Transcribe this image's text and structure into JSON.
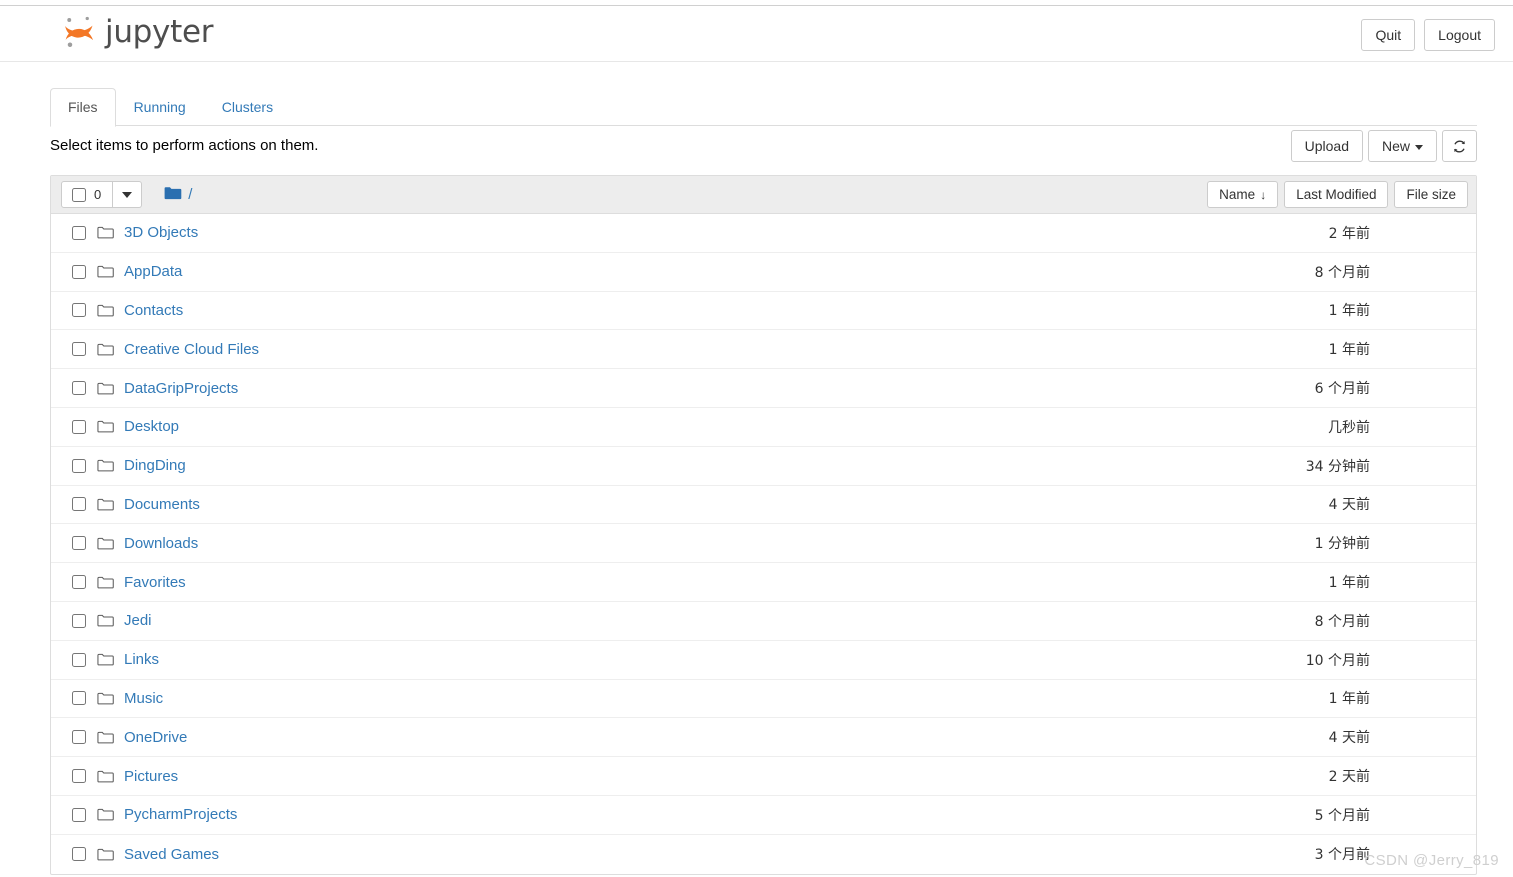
{
  "header": {
    "brand": "jupyter",
    "logo_icon": "jupyter-logo",
    "quit_label": "Quit",
    "logout_label": "Logout"
  },
  "tabs": [
    {
      "label": "Files",
      "active": true
    },
    {
      "label": "Running",
      "active": false
    },
    {
      "label": "Clusters",
      "active": false
    }
  ],
  "actions": {
    "note": "Select items to perform actions on them.",
    "upload_label": "Upload",
    "new_label": "New",
    "new_caret_icon": "chevron-down-icon",
    "refresh_icon": "refresh-icon"
  },
  "list_header": {
    "selected_count": "0",
    "select_caret_icon": "chevron-down-icon",
    "folder_icon": "folder-filled-icon",
    "breadcrumb_root": "/",
    "sort_name": "Name",
    "sort_name_arrow": "↓",
    "sort_last_modified": "Last Modified",
    "sort_file_size": "File size"
  },
  "columns": [
    "Name",
    "Last Modified",
    "File size"
  ],
  "files": [
    {
      "icon": "folder-icon",
      "name": "3D Objects",
      "modified": "2 年前",
      "size": ""
    },
    {
      "icon": "folder-icon",
      "name": "AppData",
      "modified": "8 个月前",
      "size": ""
    },
    {
      "icon": "folder-icon",
      "name": "Contacts",
      "modified": "1 年前",
      "size": ""
    },
    {
      "icon": "folder-icon",
      "name": "Creative Cloud Files",
      "modified": "1 年前",
      "size": ""
    },
    {
      "icon": "folder-icon",
      "name": "DataGripProjects",
      "modified": "6 个月前",
      "size": ""
    },
    {
      "icon": "folder-icon",
      "name": "Desktop",
      "modified": "几秒前",
      "size": ""
    },
    {
      "icon": "folder-icon",
      "name": "DingDing",
      "modified": "34 分钟前",
      "size": ""
    },
    {
      "icon": "folder-icon",
      "name": "Documents",
      "modified": "4 天前",
      "size": ""
    },
    {
      "icon": "folder-icon",
      "name": "Downloads",
      "modified": "1 分钟前",
      "size": ""
    },
    {
      "icon": "folder-icon",
      "name": "Favorites",
      "modified": "1 年前",
      "size": ""
    },
    {
      "icon": "folder-icon",
      "name": "Jedi",
      "modified": "8 个月前",
      "size": ""
    },
    {
      "icon": "folder-icon",
      "name": "Links",
      "modified": "10 个月前",
      "size": ""
    },
    {
      "icon": "folder-icon",
      "name": "Music",
      "modified": "1 年前",
      "size": ""
    },
    {
      "icon": "folder-icon",
      "name": "OneDrive",
      "modified": "4 天前",
      "size": ""
    },
    {
      "icon": "folder-icon",
      "name": "Pictures",
      "modified": "2 天前",
      "size": ""
    },
    {
      "icon": "folder-icon",
      "name": "PycharmProjects",
      "modified": "5 个月前",
      "size": ""
    },
    {
      "icon": "folder-icon",
      "name": "Saved Games",
      "modified": "3 个月前",
      "size": ""
    }
  ],
  "watermark": "CSDN @Jerry_819",
  "colors": {
    "link": "#337ab7",
    "brand_orange": "#f37726",
    "brand_gray": "#9e9e9e",
    "header_bg": "#ededed",
    "border": "#dddddd"
  }
}
